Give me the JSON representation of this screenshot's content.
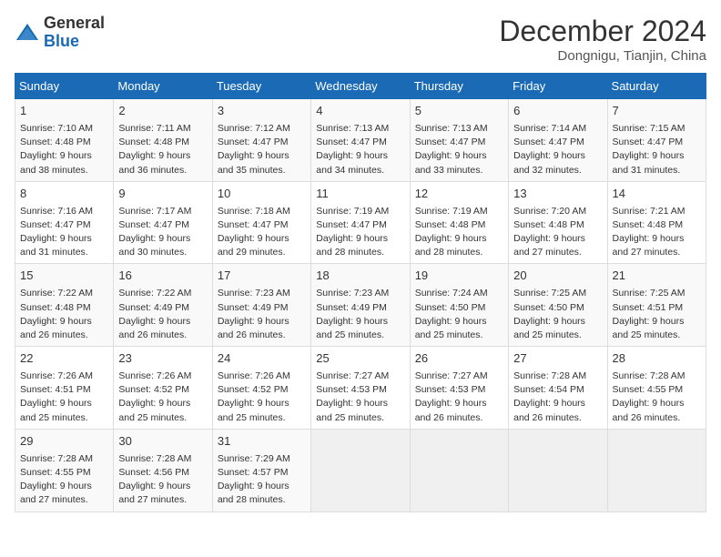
{
  "header": {
    "logo_general": "General",
    "logo_blue": "Blue",
    "month_title": "December 2024",
    "location": "Dongnigu, Tianjin, China"
  },
  "days_of_week": [
    "Sunday",
    "Monday",
    "Tuesday",
    "Wednesday",
    "Thursday",
    "Friday",
    "Saturday"
  ],
  "weeks": [
    [
      {
        "day": "1",
        "sunrise": "7:10 AM",
        "sunset": "4:48 PM",
        "daylight": "9 hours and 38 minutes."
      },
      {
        "day": "2",
        "sunrise": "7:11 AM",
        "sunset": "4:48 PM",
        "daylight": "9 hours and 36 minutes."
      },
      {
        "day": "3",
        "sunrise": "7:12 AM",
        "sunset": "4:47 PM",
        "daylight": "9 hours and 35 minutes."
      },
      {
        "day": "4",
        "sunrise": "7:13 AM",
        "sunset": "4:47 PM",
        "daylight": "9 hours and 34 minutes."
      },
      {
        "day": "5",
        "sunrise": "7:13 AM",
        "sunset": "4:47 PM",
        "daylight": "9 hours and 33 minutes."
      },
      {
        "day": "6",
        "sunrise": "7:14 AM",
        "sunset": "4:47 PM",
        "daylight": "9 hours and 32 minutes."
      },
      {
        "day": "7",
        "sunrise": "7:15 AM",
        "sunset": "4:47 PM",
        "daylight": "9 hours and 31 minutes."
      }
    ],
    [
      {
        "day": "8",
        "sunrise": "7:16 AM",
        "sunset": "4:47 PM",
        "daylight": "9 hours and 31 minutes."
      },
      {
        "day": "9",
        "sunrise": "7:17 AM",
        "sunset": "4:47 PM",
        "daylight": "9 hours and 30 minutes."
      },
      {
        "day": "10",
        "sunrise": "7:18 AM",
        "sunset": "4:47 PM",
        "daylight": "9 hours and 29 minutes."
      },
      {
        "day": "11",
        "sunrise": "7:19 AM",
        "sunset": "4:47 PM",
        "daylight": "9 hours and 28 minutes."
      },
      {
        "day": "12",
        "sunrise": "7:19 AM",
        "sunset": "4:48 PM",
        "daylight": "9 hours and 28 minutes."
      },
      {
        "day": "13",
        "sunrise": "7:20 AM",
        "sunset": "4:48 PM",
        "daylight": "9 hours and 27 minutes."
      },
      {
        "day": "14",
        "sunrise": "7:21 AM",
        "sunset": "4:48 PM",
        "daylight": "9 hours and 27 minutes."
      }
    ],
    [
      {
        "day": "15",
        "sunrise": "7:22 AM",
        "sunset": "4:48 PM",
        "daylight": "9 hours and 26 minutes."
      },
      {
        "day": "16",
        "sunrise": "7:22 AM",
        "sunset": "4:49 PM",
        "daylight": "9 hours and 26 minutes."
      },
      {
        "day": "17",
        "sunrise": "7:23 AM",
        "sunset": "4:49 PM",
        "daylight": "9 hours and 26 minutes."
      },
      {
        "day": "18",
        "sunrise": "7:23 AM",
        "sunset": "4:49 PM",
        "daylight": "9 hours and 25 minutes."
      },
      {
        "day": "19",
        "sunrise": "7:24 AM",
        "sunset": "4:50 PM",
        "daylight": "9 hours and 25 minutes."
      },
      {
        "day": "20",
        "sunrise": "7:25 AM",
        "sunset": "4:50 PM",
        "daylight": "9 hours and 25 minutes."
      },
      {
        "day": "21",
        "sunrise": "7:25 AM",
        "sunset": "4:51 PM",
        "daylight": "9 hours and 25 minutes."
      }
    ],
    [
      {
        "day": "22",
        "sunrise": "7:26 AM",
        "sunset": "4:51 PM",
        "daylight": "9 hours and 25 minutes."
      },
      {
        "day": "23",
        "sunrise": "7:26 AM",
        "sunset": "4:52 PM",
        "daylight": "9 hours and 25 minutes."
      },
      {
        "day": "24",
        "sunrise": "7:26 AM",
        "sunset": "4:52 PM",
        "daylight": "9 hours and 25 minutes."
      },
      {
        "day": "25",
        "sunrise": "7:27 AM",
        "sunset": "4:53 PM",
        "daylight": "9 hours and 25 minutes."
      },
      {
        "day": "26",
        "sunrise": "7:27 AM",
        "sunset": "4:53 PM",
        "daylight": "9 hours and 26 minutes."
      },
      {
        "day": "27",
        "sunrise": "7:28 AM",
        "sunset": "4:54 PM",
        "daylight": "9 hours and 26 minutes."
      },
      {
        "day": "28",
        "sunrise": "7:28 AM",
        "sunset": "4:55 PM",
        "daylight": "9 hours and 26 minutes."
      }
    ],
    [
      {
        "day": "29",
        "sunrise": "7:28 AM",
        "sunset": "4:55 PM",
        "daylight": "9 hours and 27 minutes."
      },
      {
        "day": "30",
        "sunrise": "7:28 AM",
        "sunset": "4:56 PM",
        "daylight": "9 hours and 27 minutes."
      },
      {
        "day": "31",
        "sunrise": "7:29 AM",
        "sunset": "4:57 PM",
        "daylight": "9 hours and 28 minutes."
      },
      null,
      null,
      null,
      null
    ]
  ],
  "labels": {
    "sunrise": "Sunrise:",
    "sunset": "Sunset:",
    "daylight": "Daylight:"
  }
}
